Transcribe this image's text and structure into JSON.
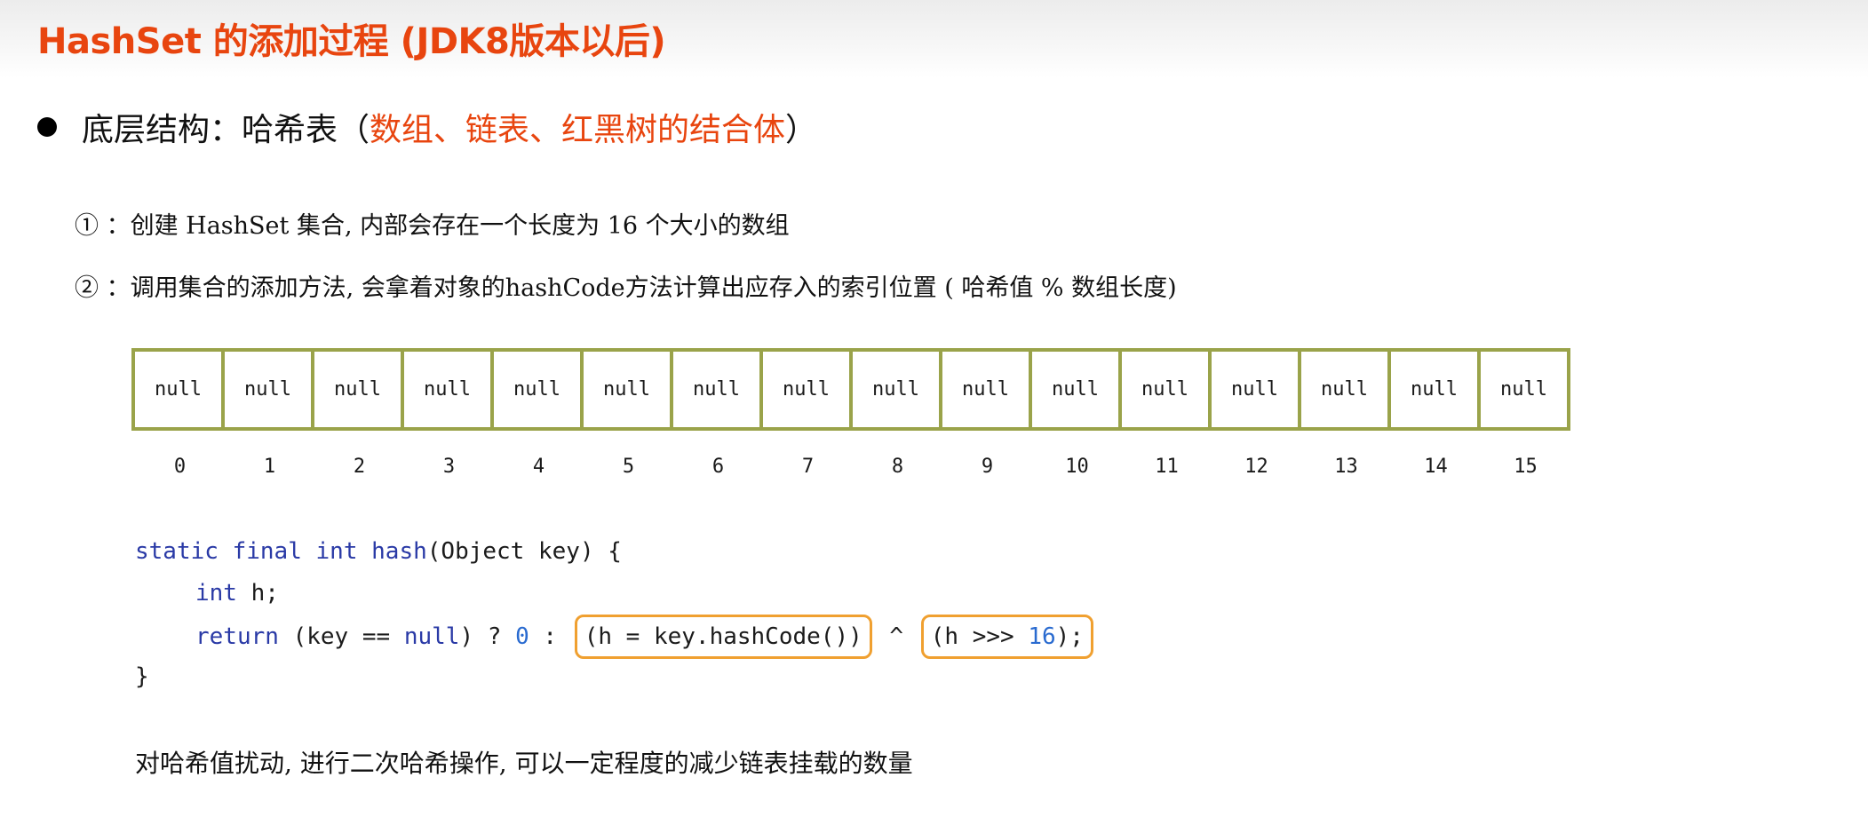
{
  "colors": {
    "accent": "#e8450f",
    "array_border": "#9aa34a",
    "code_keyword": "#2a3aa6",
    "code_number": "#2a6bd0",
    "highlight_box": "#f0a030"
  },
  "title": "HashSet 的添加过程 (JDK8版本以后)",
  "bullet": {
    "prefix": "底层结构：哈希表（",
    "highlight": "数组、链表、红黑树的结合体",
    "suffix": "）"
  },
  "steps": [
    "① ：创建 HashSet 集合, 内部会存在一个长度为 16 个大小的数组",
    "② ：调用集合的添加方法, 会拿着对象的hashCode方法计算出应存入的索引位置 ( 哈希值 % 数组长度)"
  ],
  "array": {
    "cells": [
      "null",
      "null",
      "null",
      "null",
      "null",
      "null",
      "null",
      "null",
      "null",
      "null",
      "null",
      "null",
      "null",
      "null",
      "null",
      "null"
    ],
    "indices": [
      "0",
      "1",
      "2",
      "3",
      "4",
      "5",
      "6",
      "7",
      "8",
      "9",
      "10",
      "11",
      "12",
      "13",
      "14",
      "15"
    ]
  },
  "code": {
    "line1": {
      "static": "static",
      "final": "final",
      "int": "int",
      "hash": "hash",
      "rest": "(Object key) {"
    },
    "line2": {
      "int": "int",
      "rest": " h;"
    },
    "line3": {
      "return": "return",
      "mid": " (key == ",
      "null": "null",
      "mid2": ") ? ",
      "zero": "0",
      "mid3": " : ",
      "box1": "(h = key.hashCode())",
      "xor": " ^ ",
      "box2_pre": "(h >>> ",
      "box2_num": "16",
      "box2_post": ");"
    },
    "line4": "}"
  },
  "footer": "对哈希值扰动, 进行二次哈希操作, 可以一定程度的减少链表挂载的数量"
}
